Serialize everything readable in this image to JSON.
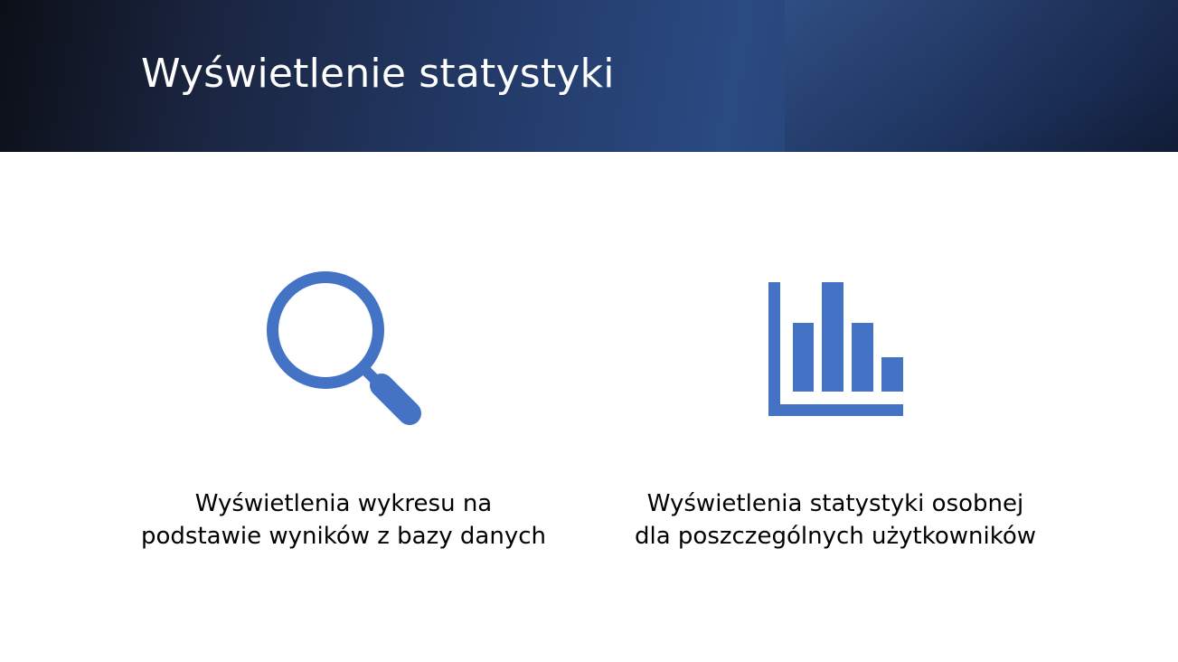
{
  "slide": {
    "title": "Wyświetlenie statystyki",
    "accent_color": "#4472C4",
    "header_color": "#2a4a82"
  },
  "features": [
    {
      "icon": "magnifying-glass-icon",
      "caption_line1": "Wyświetlenia wykresu na",
      "caption_line2": "podstawie wyników z bazy danych"
    },
    {
      "icon": "bar-chart-icon",
      "caption_line1": "Wyświetlenia statystyki osobnej",
      "caption_line2": "dla poszczególnych użytkowników"
    }
  ]
}
